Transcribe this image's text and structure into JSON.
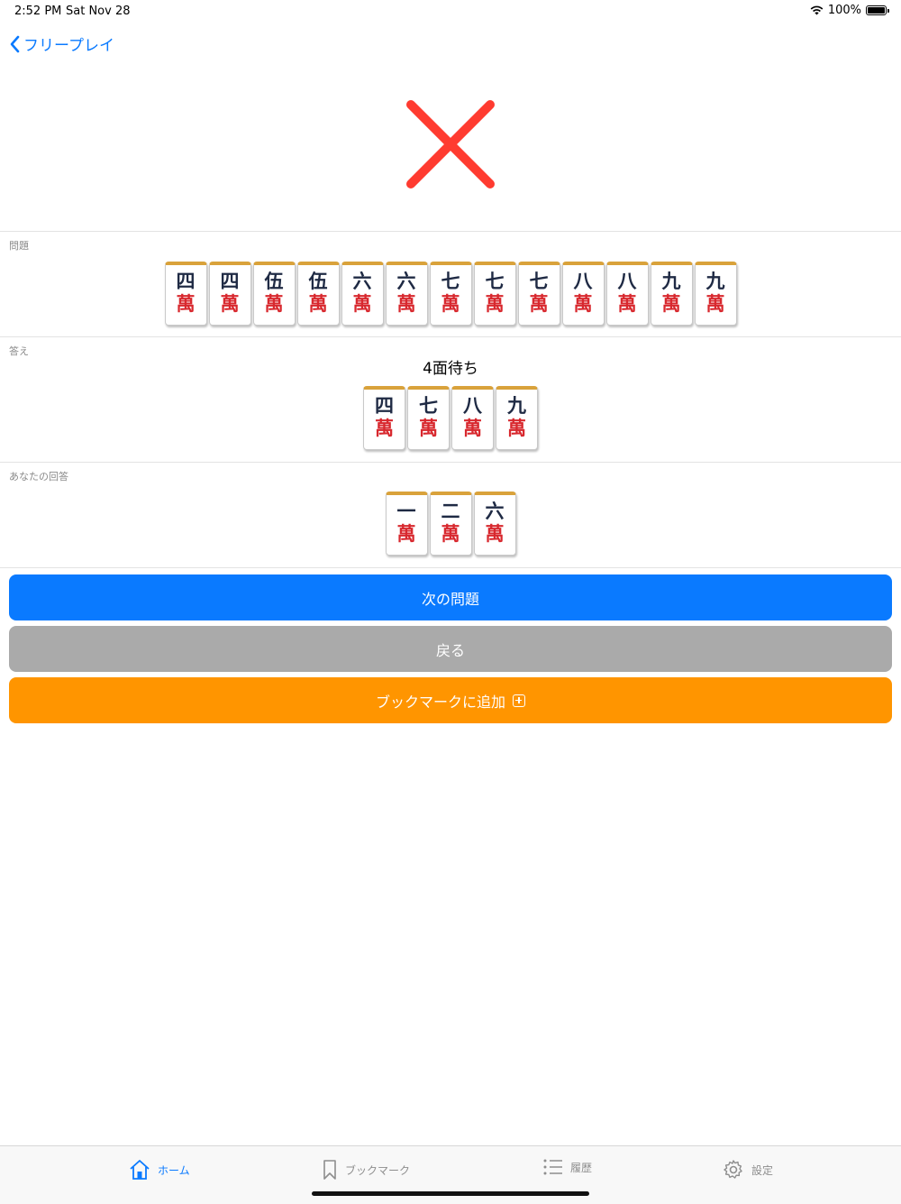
{
  "status": {
    "time": "2:52 PM",
    "date": "Sat Nov 28",
    "battery": "100%"
  },
  "nav": {
    "back_label": "フリープレイ"
  },
  "result": {
    "icon": "cross-mark-icon",
    "color": "#ff3b30"
  },
  "question": {
    "label": "問題",
    "tiles": [
      {
        "num": "四",
        "suit": "萬"
      },
      {
        "num": "四",
        "suit": "萬"
      },
      {
        "num": "伍",
        "suit": "萬"
      },
      {
        "num": "伍",
        "suit": "萬"
      },
      {
        "num": "六",
        "suit": "萬"
      },
      {
        "num": "六",
        "suit": "萬"
      },
      {
        "num": "七",
        "suit": "萬"
      },
      {
        "num": "七",
        "suit": "萬"
      },
      {
        "num": "七",
        "suit": "萬"
      },
      {
        "num": "八",
        "suit": "萬"
      },
      {
        "num": "八",
        "suit": "萬"
      },
      {
        "num": "九",
        "suit": "萬"
      },
      {
        "num": "九",
        "suit": "萬"
      }
    ]
  },
  "answer": {
    "label": "答え",
    "wait_text": "4面待ち",
    "tiles": [
      {
        "num": "四",
        "suit": "萬"
      },
      {
        "num": "七",
        "suit": "萬"
      },
      {
        "num": "八",
        "suit": "萬"
      },
      {
        "num": "九",
        "suit": "萬"
      }
    ]
  },
  "your_answer": {
    "label": "あなたの回答",
    "tiles": [
      {
        "num": "一",
        "suit": "萬"
      },
      {
        "num": "二",
        "suit": "萬"
      },
      {
        "num": "六",
        "suit": "萬"
      }
    ]
  },
  "buttons": {
    "next": "次の問題",
    "back": "戻る",
    "bookmark": "ブックマークに追加"
  },
  "tabs": [
    {
      "label": "ホーム",
      "icon": "home-icon",
      "active": true
    },
    {
      "label": "ブックマーク",
      "icon": "bookmark-icon",
      "active": false
    },
    {
      "label": "履歴",
      "icon": "list-icon",
      "active": false
    },
    {
      "label": "設定",
      "icon": "gear-icon",
      "active": false
    }
  ],
  "colors": {
    "accent": "#0a7aff",
    "gray_button": "#aaaaaa",
    "orange_button": "#ff9500",
    "tile_number": "#1f2a44",
    "tile_suit": "#d8282e"
  }
}
